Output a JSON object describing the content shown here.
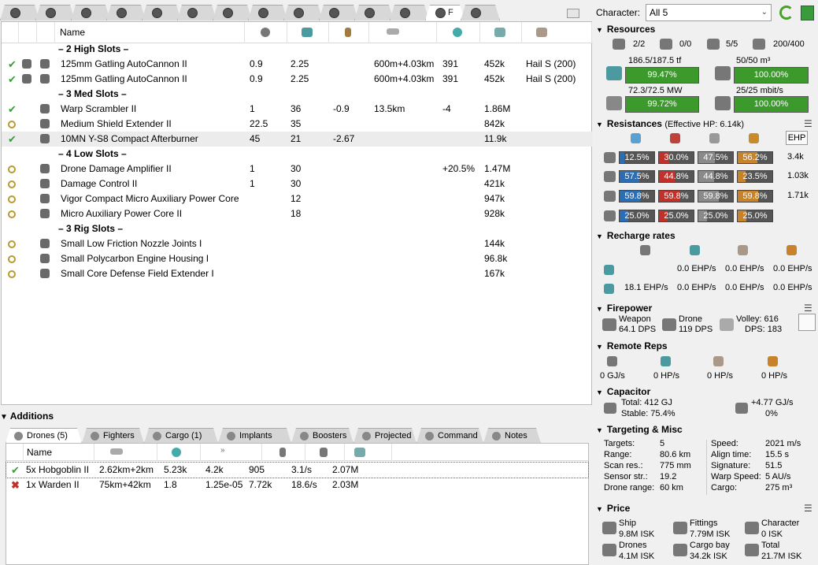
{
  "fit_tabs": [
    {
      "icon": "fit-icon",
      "label": ""
    },
    {
      "icon": "fit-icon",
      "label": ""
    },
    {
      "icon": "fit-icon",
      "label": ""
    },
    {
      "icon": "fit-icon",
      "label": ""
    },
    {
      "icon": "fit-icon",
      "label": ""
    },
    {
      "icon": "fit-icon",
      "label": ""
    },
    {
      "icon": "fit-icon",
      "label": ""
    },
    {
      "icon": "fit-icon",
      "label": ""
    },
    {
      "icon": "fit-icon",
      "label": ""
    },
    {
      "icon": "fit-icon",
      "label": ""
    },
    {
      "icon": "fit-icon",
      "label": ""
    },
    {
      "icon": "fit-icon",
      "label": ""
    },
    {
      "icon": "fit-icon",
      "label": "F"
    },
    {
      "icon": "fit-icon",
      "label": ""
    }
  ],
  "fitting": {
    "header_name": "Name",
    "sections": {
      "high": "– 2 High Slots –",
      "med": "– 3 Med Slots –",
      "low": "– 4 Low Slots –",
      "rig": "– 3 Rig Slots –"
    },
    "rows": [
      {
        "state": "active",
        "name": "125mm Gatling AutoCannon II",
        "v1": "0.9",
        "v2": "2.25",
        "v3": "",
        "v4": "600m+4.03km",
        "v5": "391",
        "v6": "452k",
        "v7": "Hail S (200)"
      },
      {
        "state": "active",
        "name": "125mm Gatling AutoCannon II",
        "v1": "0.9",
        "v2": "2.25",
        "v3": "",
        "v4": "600m+4.03km",
        "v5": "391",
        "v6": "452k",
        "v7": "Hail S (200)"
      },
      {
        "state": "active",
        "name": "Warp Scrambler II",
        "v1": "1",
        "v2": "36",
        "v3": "-0.9",
        "v4": "13.5km",
        "v5": "-4",
        "v6": "1.86M",
        "v7": ""
      },
      {
        "state": "online",
        "name": "Medium Shield Extender II",
        "v1": "22.5",
        "v2": "35",
        "v3": "",
        "v4": "",
        "v5": "",
        "v6": "842k",
        "v7": ""
      },
      {
        "state": "active",
        "name": "10MN Y-S8 Compact Afterburner",
        "v1": "45",
        "v2": "21",
        "v3": "-2.67",
        "v4": "",
        "v5": "",
        "v6": "11.9k",
        "v7": ""
      },
      {
        "state": "online",
        "name": "Drone Damage Amplifier II",
        "v1": "1",
        "v2": "30",
        "v3": "",
        "v4": "",
        "v5": "+20.5%",
        "v6": "1.47M",
        "v7": ""
      },
      {
        "state": "online",
        "name": "Damage Control II",
        "v1": "1",
        "v2": "30",
        "v3": "",
        "v4": "",
        "v5": "",
        "v6": "421k",
        "v7": ""
      },
      {
        "state": "online",
        "name": "Vigor Compact Micro Auxiliary Power Core",
        "v1": "",
        "v2": "12",
        "v3": "",
        "v4": "",
        "v5": "",
        "v6": "947k",
        "v7": ""
      },
      {
        "state": "online",
        "name": "Micro Auxiliary Power Core II",
        "v1": "",
        "v2": "18",
        "v3": "",
        "v4": "",
        "v5": "",
        "v6": "928k",
        "v7": ""
      },
      {
        "state": "online",
        "name": "Small Low Friction Nozzle Joints I",
        "v1": "",
        "v2": "",
        "v3": "",
        "v4": "",
        "v5": "",
        "v6": "144k",
        "v7": ""
      },
      {
        "state": "online",
        "name": "Small Polycarbon Engine Housing I",
        "v1": "",
        "v2": "",
        "v3": "",
        "v4": "",
        "v5": "",
        "v6": "96.8k",
        "v7": ""
      },
      {
        "state": "online",
        "name": "Small Core Defense Field Extender I",
        "v1": "",
        "v2": "",
        "v3": "",
        "v4": "",
        "v5": "",
        "v6": "167k",
        "v7": ""
      }
    ]
  },
  "additions": {
    "title": "Additions",
    "tabs": [
      "Drones (5)",
      "Fighters",
      "Cargo (1)",
      "Implants",
      "Boosters",
      "Projected",
      "Command",
      "Notes"
    ],
    "header_name": "Name",
    "drones": [
      {
        "state": "active",
        "name": "5x Hobgoblin II",
        "range": "2.62km+2km",
        "c2": "5.23k",
        "c3": "4.2k",
        "c4": "905",
        "c5": "3.1/s",
        "c6": "2.07M"
      },
      {
        "state": "inactive",
        "name": "1x Warden II",
        "range": "75km+42km",
        "c2": "1.8",
        "c3": "1.25e-05",
        "c4": "7.72k",
        "c5": "18.6/s",
        "c6": "2.03M"
      }
    ]
  },
  "character": {
    "label": "Character:",
    "value": "All 5"
  },
  "resources": {
    "title": "Resources",
    "counts": [
      "2/2",
      "0/0",
      "5/5",
      "200/400"
    ],
    "cpu_text": "186.5/187.5 tf",
    "cpu_pct": "99.47%",
    "drone_bay_text": "50/50 m³",
    "drone_bay_pct": "100.00%",
    "power_text": "72.3/72.5 MW",
    "power_pct": "99.72%",
    "bandwidth_text": "25/25 mbit/s",
    "bandwidth_pct": "100.00%"
  },
  "resistances": {
    "title": "Resistances",
    "ehp_title": "(Effective HP: 6.14k)",
    "ehp_button": "EHP",
    "rows": [
      {
        "layer": "shield",
        "values": [
          "12.5%",
          "30.0%",
          "47.5%",
          "56.2%"
        ],
        "ehp": "3.4k"
      },
      {
        "layer": "armor",
        "values": [
          "57.5%",
          "44.8%",
          "44.8%",
          "23.5%"
        ],
        "ehp": "1.03k"
      },
      {
        "layer": "hull",
        "values": [
          "59.8%",
          "59.8%",
          "59.8%",
          "59.8%"
        ],
        "ehp": "1.71k"
      },
      {
        "layer": "damage-pattern",
        "values": [
          "25.0%",
          "25.0%",
          "25.0%",
          "25.0%"
        ],
        "ehp": ""
      }
    ],
    "colors": [
      "#2a6eb5",
      "#c2302a",
      "#8a8a8a",
      "#c8832a"
    ]
  },
  "recharge": {
    "title": "Recharge rates",
    "rows": [
      [
        "",
        "0.0 EHP/s",
        "0.0 EHP/s",
        "0.0 EHP/s"
      ],
      [
        "18.1 EHP/s",
        "0.0 EHP/s",
        "0.0 EHP/s",
        "0.0 EHP/s"
      ]
    ]
  },
  "firepower": {
    "title": "Firepower",
    "weapon_label": "Weapon",
    "weapon_dps": "64.1 DPS",
    "drone_label": "Drone",
    "drone_dps": "119 DPS",
    "volley": "Volley: 616",
    "dps": "DPS: 183"
  },
  "remote_reps": {
    "title": "Remote Reps",
    "values": [
      "0 GJ/s",
      "0 HP/s",
      "0 HP/s",
      "0 HP/s"
    ]
  },
  "capacitor": {
    "title": "Capacitor",
    "total": "Total: 412 GJ",
    "stable": "Stable: 75.4%",
    "delta": "+4.77 GJ/s",
    "delta_pct": "0%"
  },
  "targeting": {
    "title": "Targeting & Misc",
    "left": [
      {
        "label": "Targets:",
        "value": "5"
      },
      {
        "label": "Range:",
        "value": "80.6 km"
      },
      {
        "label": "Scan res.:",
        "value": "775 mm"
      },
      {
        "label": "Sensor str.:",
        "value": "19.2"
      },
      {
        "label": "Drone range:",
        "value": "60 km"
      }
    ],
    "right": [
      {
        "label": "Speed:",
        "value": "2021 m/s"
      },
      {
        "label": "Align time:",
        "value": "15.5 s"
      },
      {
        "label": "Signature:",
        "value": "51.5"
      },
      {
        "label": "Warp Speed:",
        "value": "5 AU/s"
      },
      {
        "label": "Cargo:",
        "value": "275 m³"
      }
    ]
  },
  "price": {
    "title": "Price",
    "items": [
      {
        "label": "Ship",
        "value": "9.8M ISK"
      },
      {
        "label": "Fittings",
        "value": "7.79M ISK"
      },
      {
        "label": "Character",
        "value": "0 ISK"
      },
      {
        "label": "Drones",
        "value": "4.1M ISK"
      },
      {
        "label": "Cargo bay",
        "value": "34.2k ISK"
      },
      {
        "label": "Total",
        "value": "21.7M ISK"
      }
    ]
  }
}
